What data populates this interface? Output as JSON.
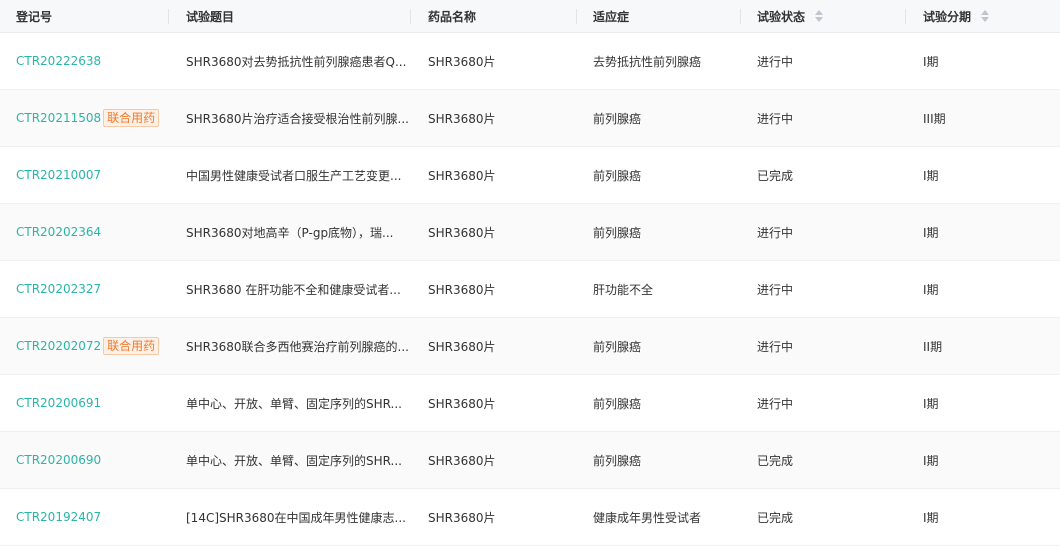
{
  "header": {
    "reg_no": "登记号",
    "title": "试验题目",
    "drug": "药品名称",
    "indication": "适应症",
    "status": "试验状态",
    "phase": "试验分期"
  },
  "rows": [
    {
      "reg_no": "CTR20222638",
      "tag": "",
      "title": "SHR3680对去势抵抗性前列腺癌患者Q...",
      "drug": "SHR3680片",
      "indication": "去势抵抗性前列腺癌",
      "status": "进行中",
      "phase": "I期"
    },
    {
      "reg_no": "CTR20211508",
      "tag": "联合用药",
      "title": "SHR3680片治疗适合接受根治性前列腺...",
      "drug": "SHR3680片",
      "indication": "前列腺癌",
      "status": "进行中",
      "phase": "III期"
    },
    {
      "reg_no": "CTR20210007",
      "tag": "",
      "title": "中国男性健康受试者口服生产工艺变更...",
      "drug": "SHR3680片",
      "indication": "前列腺癌",
      "status": "已完成",
      "phase": "I期"
    },
    {
      "reg_no": "CTR20202364",
      "tag": "",
      "title": "SHR3680对地高辛（P-gp底物），瑞...",
      "drug": "SHR3680片",
      "indication": "前列腺癌",
      "status": "进行中",
      "phase": "I期"
    },
    {
      "reg_no": "CTR20202327",
      "tag": "",
      "title": "SHR3680 在肝功能不全和健康受试者...",
      "drug": "SHR3680片",
      "indication": "肝功能不全",
      "status": "进行中",
      "phase": "I期"
    },
    {
      "reg_no": "CTR20202072",
      "tag": "联合用药",
      "title": "SHR3680联合多西他赛治疗前列腺癌的...",
      "drug": "SHR3680片",
      "indication": "前列腺癌",
      "status": "进行中",
      "phase": "II期"
    },
    {
      "reg_no": "CTR20200691",
      "tag": "",
      "title": "单中心、开放、单臂、固定序列的SHR...",
      "drug": "SHR3680片",
      "indication": "前列腺癌",
      "status": "进行中",
      "phase": "I期"
    },
    {
      "reg_no": "CTR20200690",
      "tag": "",
      "title": "单中心、开放、单臂、固定序列的SHR...",
      "drug": "SHR3680片",
      "indication": "前列腺癌",
      "status": "已完成",
      "phase": "I期"
    },
    {
      "reg_no": "CTR20192407",
      "tag": "",
      "title": "[14C]SHR3680在中国成年男性健康志...",
      "drug": "SHR3680片",
      "indication": "健康成年男性受试者",
      "status": "已完成",
      "phase": "I期"
    }
  ],
  "icons": {
    "sort": "sort-caret-icon"
  },
  "colors": {
    "link": "#2bb5a6",
    "tag_text": "#f07a2f",
    "header_bg": "#f7f8fa"
  }
}
